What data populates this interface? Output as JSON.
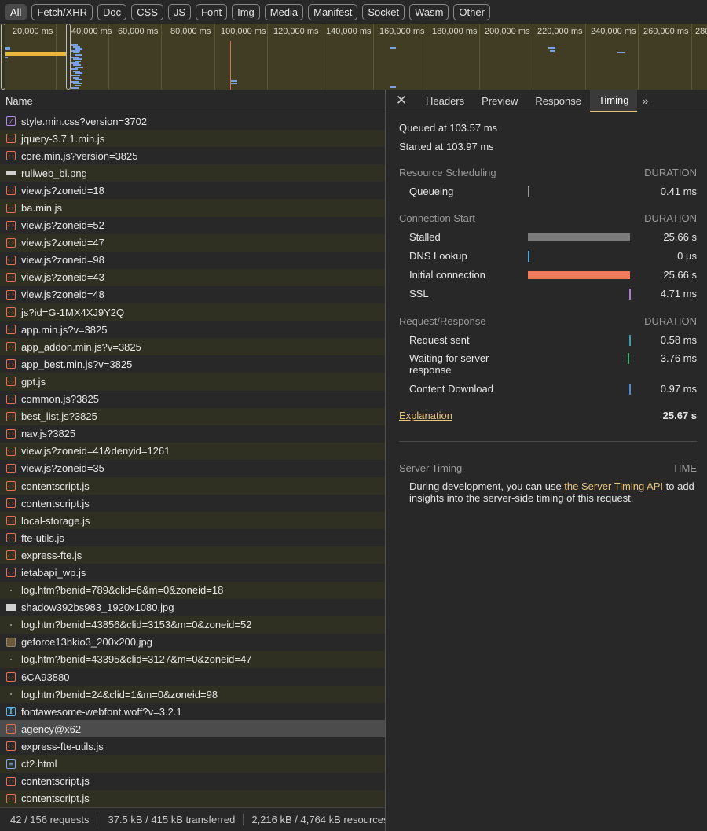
{
  "filters": [
    "All",
    "Fetch/XHR",
    "Doc",
    "CSS",
    "JS",
    "Font",
    "Img",
    "Media",
    "Manifest",
    "Socket",
    "Wasm",
    "Other"
  ],
  "overview": {
    "ticks": [
      "20,000 ms",
      "40,000 ms",
      "60,000 ms",
      "80,000 ms",
      "100,000 ms",
      "120,000 ms",
      "140,000 ms",
      "160,000 ms",
      "180,000 ms",
      "200,000 ms",
      "220,000 ms",
      "240,000 ms",
      "260,000 ms",
      "280"
    ],
    "colors": {
      "background": "#403d24",
      "bars": "#7aa2e0",
      "load": "#e8b53c"
    }
  },
  "list": {
    "header": "Name",
    "rows": [
      {
        "name": "style.min.css?version=3702",
        "icon": "style"
      },
      {
        "name": "jquery-3.7.1.min.js",
        "icon": "script"
      },
      {
        "name": "core.min.js?version=3825",
        "icon": "script"
      },
      {
        "name": "ruliweb_bi.png",
        "icon": "image"
      },
      {
        "name": "view.js?zoneid=18",
        "icon": "script"
      },
      {
        "name": "ba.min.js",
        "icon": "script"
      },
      {
        "name": "view.js?zoneid=52",
        "icon": "script"
      },
      {
        "name": "view.js?zoneid=47",
        "icon": "script"
      },
      {
        "name": "view.js?zoneid=98",
        "icon": "script"
      },
      {
        "name": "view.js?zoneid=43",
        "icon": "script"
      },
      {
        "name": "view.js?zoneid=48",
        "icon": "script"
      },
      {
        "name": "js?id=G-1MX4XJ9Y2Q",
        "icon": "script"
      },
      {
        "name": "app.min.js?v=3825",
        "icon": "script"
      },
      {
        "name": "app_addon.min.js?v=3825",
        "icon": "script"
      },
      {
        "name": "app_best.min.js?v=3825",
        "icon": "script"
      },
      {
        "name": "gpt.js",
        "icon": "script"
      },
      {
        "name": "common.js?3825",
        "icon": "script"
      },
      {
        "name": "best_list.js?3825",
        "icon": "script"
      },
      {
        "name": "nav.js?3825",
        "icon": "script"
      },
      {
        "name": "view.js?zoneid=41&denyid=1261",
        "icon": "script"
      },
      {
        "name": "view.js?zoneid=35",
        "icon": "script"
      },
      {
        "name": "contentscript.js",
        "icon": "script"
      },
      {
        "name": "contentscript.js",
        "icon": "script"
      },
      {
        "name": "local-storage.js",
        "icon": "script"
      },
      {
        "name": "fte-utils.js",
        "icon": "script"
      },
      {
        "name": "express-fte.js",
        "icon": "script"
      },
      {
        "name": "ietabapi_wp.js",
        "icon": "script"
      },
      {
        "name": "log.htm?benid=789&clid=6&m=0&zoneid=18",
        "icon": "dot"
      },
      {
        "name": "shadow392bs983_1920x1080.jpg",
        "icon": "image2"
      },
      {
        "name": "log.htm?benid=43856&clid=3153&m=0&zoneid=52",
        "icon": "dot"
      },
      {
        "name": "geforce13hkio3_200x200.jpg",
        "icon": "thumb"
      },
      {
        "name": "log.htm?benid=43395&clid=3127&m=0&zoneid=47",
        "icon": "dot"
      },
      {
        "name": "6CA93880",
        "icon": "script"
      },
      {
        "name": "log.htm?benid=24&clid=1&m=0&zoneid=98",
        "icon": "dot"
      },
      {
        "name": "fontawesome-webfont.woff?v=3.2.1",
        "icon": "font"
      },
      {
        "name": "agency@x62",
        "icon": "script",
        "selected": true
      },
      {
        "name": "express-fte-utils.js",
        "icon": "script"
      },
      {
        "name": "ct2.html",
        "icon": "doc"
      },
      {
        "name": "contentscript.js",
        "icon": "script"
      },
      {
        "name": "contentscript.js",
        "icon": "script"
      }
    ]
  },
  "status": {
    "requests": "42 / 156 requests",
    "transferred": "37.5 kB / 415 kB transferred",
    "resources": "2,216 kB / 4,764 kB resources"
  },
  "details": {
    "tabs": [
      "Headers",
      "Preview",
      "Response",
      "Timing"
    ],
    "active_tab": "Timing",
    "queued": "Queued at 103.57 ms",
    "started": "Started at 103.97 ms",
    "duration_label": "DURATION",
    "sections": [
      {
        "title": "Resource Scheduling",
        "rows": [
          {
            "label": "Queueing",
            "value": "0.41 ms",
            "color": "#9a9a9a"
          }
        ]
      },
      {
        "title": "Connection Start",
        "rows": [
          {
            "label": "Stalled",
            "value": "25.66 s",
            "color": "#7b7b7b"
          },
          {
            "label": "DNS Lookup",
            "value": "0 µs",
            "color": "#4fa3d9"
          },
          {
            "label": "Initial connection",
            "value": "25.66 s",
            "color": "#f07a5a"
          },
          {
            "label": "SSL",
            "value": "4.71 ms",
            "color": "#b07ad8"
          }
        ]
      },
      {
        "title": "Request/Response",
        "rows": [
          {
            "label": "Request sent",
            "value": "0.58 ms",
            "color": "#3aa0b8"
          },
          {
            "label": "Waiting for server response",
            "value": "3.76 ms",
            "color": "#3cae6a"
          },
          {
            "label": "Content Download",
            "value": "0.97 ms",
            "color": "#4f8ae0"
          }
        ]
      }
    ],
    "explanation": "Explanation",
    "total": "25.67 s",
    "server_timing": {
      "title": "Server Timing",
      "time_label": "TIME",
      "text_before": "During development, you can use ",
      "link": "the Server Timing API",
      "text_after": " to add insights into the server-side timing of this request."
    }
  }
}
